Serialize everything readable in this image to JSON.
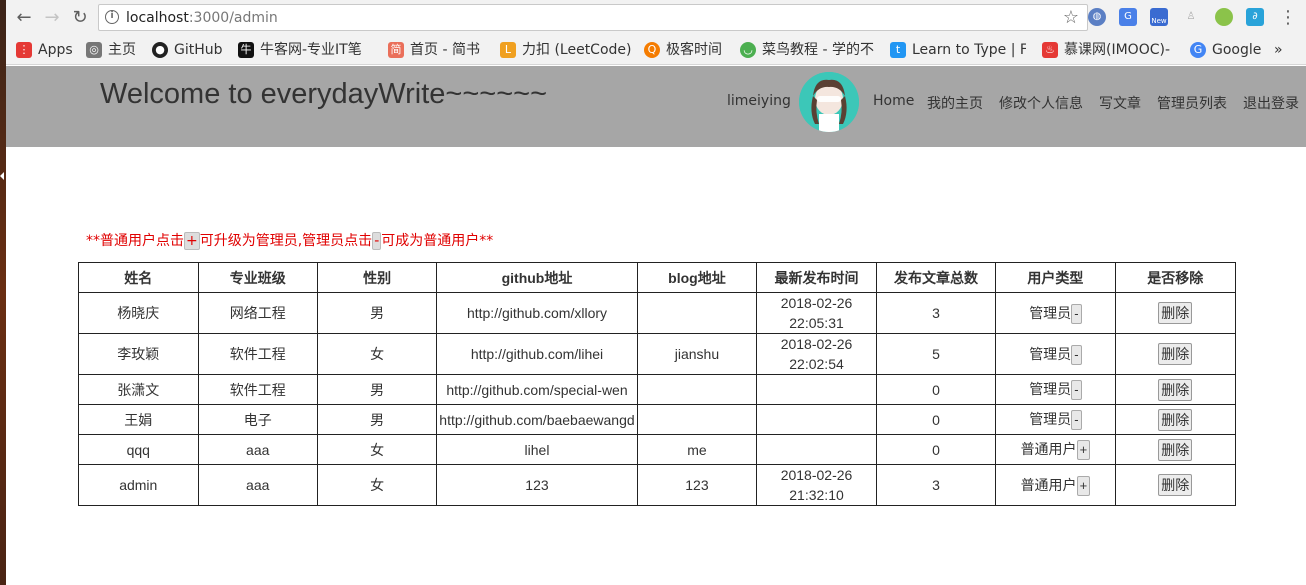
{
  "browser": {
    "url_host": "localhost",
    "url_path": ":3000/admin",
    "bookmarks": [
      {
        "label": "Apps",
        "icon": "apps-grid-icon",
        "color": "#e53935"
      },
      {
        "label": "主页",
        "icon": "home-globe-icon",
        "color": "#777777"
      },
      {
        "label": "GitHub",
        "icon": "github-icon",
        "color": "#222222"
      },
      {
        "label": "牛客网-专业IT笔",
        "icon": "nowcoder-icon",
        "color": "#111111"
      },
      {
        "label": "首页 - 简书",
        "icon": "jianshu-icon",
        "color": "#ea6f5a"
      },
      {
        "label": "力扣 (LeetCode)",
        "icon": "leetcode-icon",
        "color": "#f0a020"
      },
      {
        "label": "极客时间",
        "icon": "geektime-icon",
        "color": "#f57c00"
      },
      {
        "label": "菜鸟教程 - 学的不",
        "icon": "runoob-icon",
        "color": "#4caf50"
      },
      {
        "label": "Learn to Type | F",
        "icon": "typing-icon",
        "color": "#2196f3"
      },
      {
        "label": "慕课网(IMOOC)-",
        "icon": "imooc-icon",
        "color": "#e53935"
      },
      {
        "label": "Google",
        "icon": "google-icon",
        "color": "#4285f4"
      }
    ],
    "more_bookmarks": "»",
    "ext_new_badge": "New"
  },
  "header": {
    "title": "Welcome to everydayWrite~~~~~~",
    "username": "limeiying",
    "nav": [
      "Home",
      "我的主页",
      "修改个人信息",
      "写文章",
      "管理员列表",
      "退出登录"
    ]
  },
  "notice": {
    "part1": "**普通用户点击",
    "plus": "+",
    "part2": "可升级为管理员,管理员点击",
    "minus": "-",
    "part3": "可成为普通用户**"
  },
  "table": {
    "headers": [
      "姓名",
      "专业班级",
      "性别",
      "github地址",
      "blog地址",
      "最新发布时间",
      "发布文章总数",
      "用户类型",
      "是否移除"
    ],
    "delete_label": "删除",
    "rows": [
      {
        "name": "杨晓庆",
        "major": "网络工程",
        "gender": "男",
        "github": "http://github.com/xllory",
        "blog": "",
        "date": "2018-02-26",
        "time": "22:05:31",
        "count": "3",
        "type": "管理员",
        "toggle": "-"
      },
      {
        "name": "李玫颖",
        "major": "软件工程",
        "gender": "女",
        "github": "http://github.com/lihei",
        "blog": "jianshu",
        "date": "2018-02-26",
        "time": "22:02:54",
        "count": "5",
        "type": "管理员",
        "toggle": "-"
      },
      {
        "name": "张潇文",
        "major": "软件工程",
        "gender": "男",
        "github": "http://github.com/special-wen",
        "blog": "",
        "date": "",
        "time": "",
        "count": "0",
        "type": "管理员",
        "toggle": "-"
      },
      {
        "name": "王娟",
        "major": "电子",
        "gender": "男",
        "github": "http://github.com/baebaewangd",
        "blog": "",
        "date": "",
        "time": "",
        "count": "0",
        "type": "管理员",
        "toggle": "-"
      },
      {
        "name": "qqq",
        "major": "aaa",
        "gender": "女",
        "github": "lihel",
        "blog": "me",
        "date": "",
        "time": "",
        "count": "0",
        "type": "普通用户",
        "toggle": "+"
      },
      {
        "name": "admin",
        "major": "aaa",
        "gender": "女",
        "github": "123",
        "blog": "123",
        "date": "2018-02-26",
        "time": "21:32:10",
        "count": "3",
        "type": "普通用户",
        "toggle": "+"
      }
    ]
  }
}
